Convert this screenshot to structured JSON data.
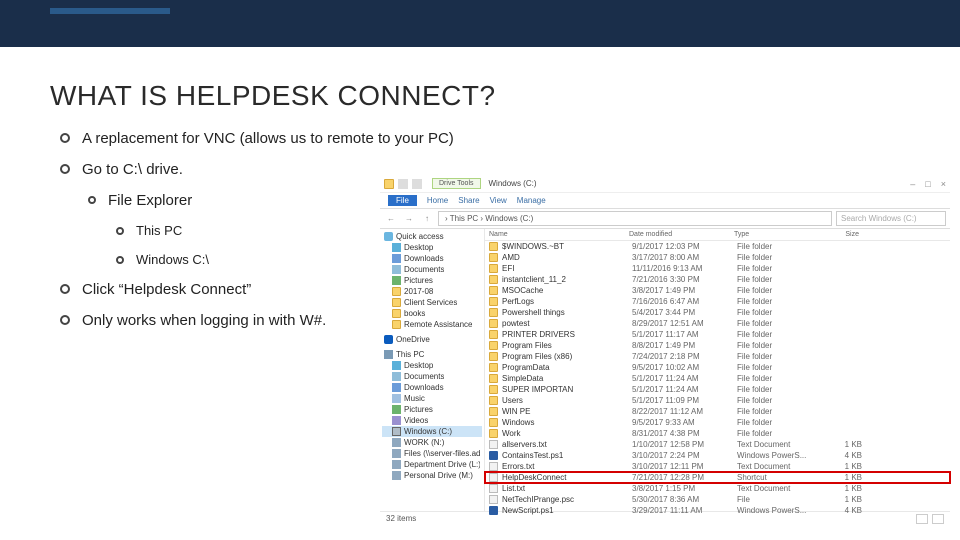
{
  "slide": {
    "title": "WHAT IS HELPDESK CONNECT?",
    "bullets": {
      "b1": "A replacement for VNC (allows us to remote to your PC)",
      "b2": "Go to C:\\ drive.",
      "b2a": "File Explorer",
      "b2a1": "This PC",
      "b2a2": "Windows C:\\",
      "b3": "Click “Helpdesk Connect”",
      "b4": "Only works when logging in with W#."
    }
  },
  "explorer": {
    "titlebar": {
      "drive_tools": "Drive Tools",
      "title": "Windows (C:)",
      "close": "×",
      "max": "□",
      "min": "–"
    },
    "ribbon": {
      "file": "File",
      "home": "Home",
      "share": "Share",
      "view": "View",
      "manage": "Manage"
    },
    "address": {
      "back": "←",
      "fwd": "→",
      "up": "↑",
      "path": "› This PC › Windows (C:)",
      "search_placeholder": "Search Windows (C:)"
    },
    "nav": {
      "quick_access": "Quick access",
      "desktop": "Desktop",
      "downloads": "Downloads",
      "documents": "Documents",
      "pictures": "Pictures",
      "f2017": "2017-08",
      "client_services": "Client Services",
      "books": "books",
      "remote_assist": "Remote Assistance",
      "onedrive": "OneDrive",
      "this_pc": "This PC",
      "desktop2": "Desktop",
      "documents2": "Documents",
      "downloads2": "Downloads",
      "music": "Music",
      "pictures2": "Pictures",
      "videos": "Videos",
      "windows_c": "Windows (C:)",
      "work_n": "WORK (N:)",
      "files_server": "Files (\\\\server-files.ad...",
      "dept_drive": "Department Drive (L:)",
      "personal_drive": "Personal Drive (M:)"
    },
    "columns": {
      "name": "Name",
      "date": "Date modified",
      "type": "Type",
      "size": "Size"
    },
    "rows": [
      {
        "icon": "folder",
        "name": "$WINDOWS.~BT",
        "date": "9/1/2017 12:03 PM",
        "type": "File folder",
        "size": ""
      },
      {
        "icon": "folder",
        "name": "AMD",
        "date": "3/17/2017 8:00 AM",
        "type": "File folder",
        "size": ""
      },
      {
        "icon": "folder",
        "name": "EFI",
        "date": "11/11/2016 9:13 AM",
        "type": "File folder",
        "size": ""
      },
      {
        "icon": "folder",
        "name": "instantclient_11_2",
        "date": "7/21/2016 3:30 PM",
        "type": "File folder",
        "size": ""
      },
      {
        "icon": "folder",
        "name": "MSOCache",
        "date": "3/8/2017 1:49 PM",
        "type": "File folder",
        "size": ""
      },
      {
        "icon": "folder",
        "name": "PerfLogs",
        "date": "7/16/2016 6:47 AM",
        "type": "File folder",
        "size": ""
      },
      {
        "icon": "folder",
        "name": "Powershell things",
        "date": "5/4/2017 3:44 PM",
        "type": "File folder",
        "size": ""
      },
      {
        "icon": "folder",
        "name": "powtest",
        "date": "8/29/2017 12:51 AM",
        "type": "File folder",
        "size": ""
      },
      {
        "icon": "folder",
        "name": "PRINTER DRIVERS",
        "date": "5/1/2017 11:17 AM",
        "type": "File folder",
        "size": ""
      },
      {
        "icon": "folder",
        "name": "Program Files",
        "date": "8/8/2017 1:49 PM",
        "type": "File folder",
        "size": ""
      },
      {
        "icon": "folder",
        "name": "Program Files (x86)",
        "date": "7/24/2017 2:18 PM",
        "type": "File folder",
        "size": ""
      },
      {
        "icon": "folder",
        "name": "ProgramData",
        "date": "9/5/2017 10:02 AM",
        "type": "File folder",
        "size": ""
      },
      {
        "icon": "folder",
        "name": "SimpleData",
        "date": "5/1/2017 11:24 AM",
        "type": "File folder",
        "size": ""
      },
      {
        "icon": "folder",
        "name": "SUPER IMPORTAN",
        "date": "5/1/2017 11:24 AM",
        "type": "File folder",
        "size": ""
      },
      {
        "icon": "folder",
        "name": "Users",
        "date": "5/1/2017 11:09 PM",
        "type": "File folder",
        "size": ""
      },
      {
        "icon": "folder",
        "name": "WIN PE",
        "date": "8/22/2017 11:12 AM",
        "type": "File folder",
        "size": ""
      },
      {
        "icon": "folder",
        "name": "Windows",
        "date": "9/5/2017 9:33 AM",
        "type": "File folder",
        "size": ""
      },
      {
        "icon": "folder",
        "name": "Work",
        "date": "8/31/2017 4:38 PM",
        "type": "File folder",
        "size": ""
      },
      {
        "icon": "txt",
        "name": "allservers.txt",
        "date": "1/10/2017 12:58 PM",
        "type": "Text Document",
        "size": "1 KB"
      },
      {
        "icon": "ps1",
        "name": "ContainsTest.ps1",
        "date": "3/10/2017 2:24 PM",
        "type": "Windows PowerS...",
        "size": "4 KB"
      },
      {
        "icon": "txt",
        "name": "Errors.txt",
        "date": "3/10/2017 12:11 PM",
        "type": "Text Document",
        "size": "1 KB"
      },
      {
        "icon": "shortcut",
        "name": "HelpDeskConnect",
        "date": "7/21/2017 12:28 PM",
        "type": "Shortcut",
        "size": "1 KB",
        "highlight": true
      },
      {
        "icon": "txt",
        "name": "List.txt",
        "date": "3/8/2017 1:15 PM",
        "type": "Text Document",
        "size": "1 KB"
      },
      {
        "icon": "txt",
        "name": "NetTechIPrange.psc",
        "date": "5/30/2017 8:36 AM",
        "type": "File",
        "size": "1 KB"
      },
      {
        "icon": "ps1",
        "name": "NewScript.ps1",
        "date": "3/29/2017 11:11 AM",
        "type": "Windows PowerS...",
        "size": "4 KB"
      }
    ],
    "status": {
      "items": "32 items"
    }
  }
}
